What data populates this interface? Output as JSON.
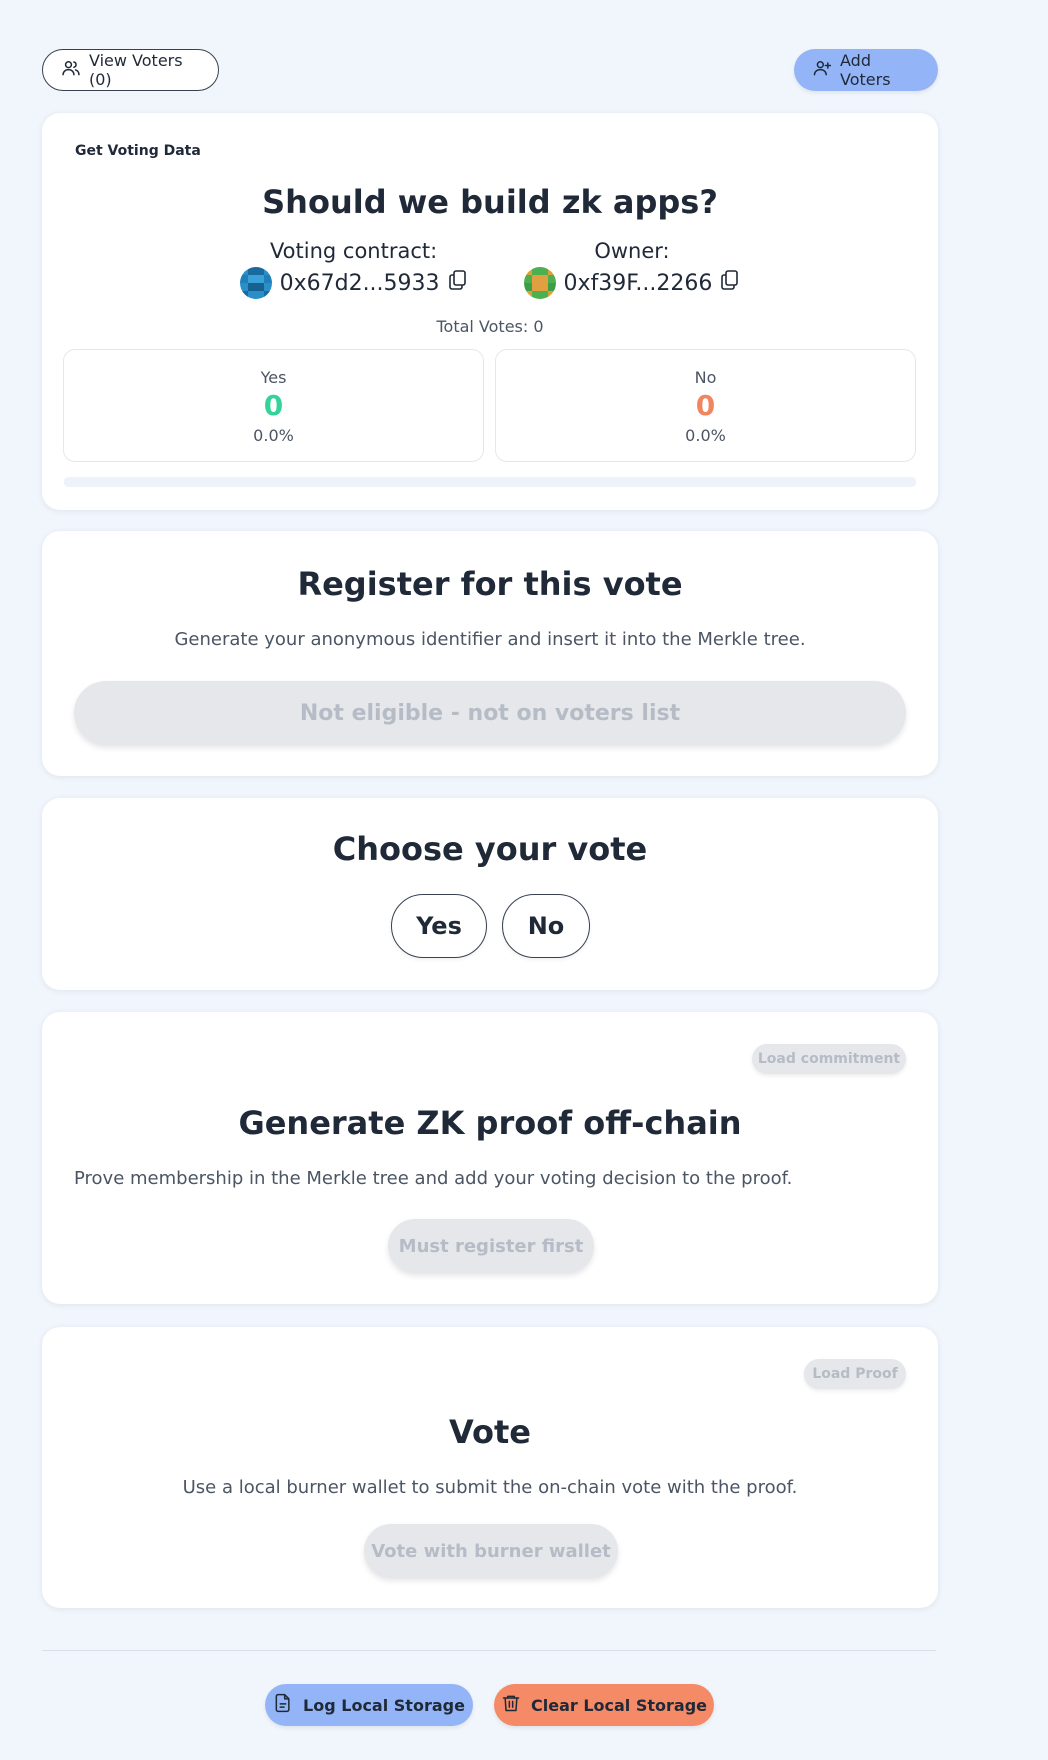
{
  "header": {
    "view_voters_label": "View Voters (0)",
    "add_voters_label": "Add Voters"
  },
  "poll": {
    "get_data_label": "Get Voting Data",
    "question": "Should we build zk apps?",
    "contract_label": "Voting contract:",
    "contract_address": "0x67d2...5933",
    "owner_label": "Owner:",
    "owner_address": "0xf39F...2266",
    "total_votes": "Total Votes: 0",
    "yes": {
      "label": "Yes",
      "count": "0",
      "percent": "0.0%",
      "color": "#34d399"
    },
    "no": {
      "label": "No",
      "count": "0",
      "percent": "0.0%",
      "color": "#f0855f"
    },
    "progress_fraction": 0
  },
  "register": {
    "title": "Register for this vote",
    "description": "Generate your anonymous identifier and insert it into the Merkle tree.",
    "button_label": "Not eligible - not on voters list"
  },
  "choose": {
    "title": "Choose your vote",
    "yes_label": "Yes",
    "no_label": "No"
  },
  "proof": {
    "chip_label": "Load commitment",
    "title": "Generate ZK proof off-chain",
    "description": "Prove membership in the Merkle tree and add your voting decision to the proof.",
    "button_label": "Must register first"
  },
  "vote": {
    "chip_label": "Load Proof",
    "title": "Vote",
    "description": "Use a local burner wallet to submit the on-chain vote with the proof.",
    "button_label": "Vote with burner wallet"
  },
  "footer": {
    "log_label": "Log Local Storage",
    "clear_label": "Clear Local Storage",
    "log_color": "#93b5f7",
    "clear_color": "#f58a66"
  },
  "icons": {
    "users": "users-icon",
    "user_plus": "user-plus-icon",
    "copy": "copy-icon",
    "document": "document-icon",
    "trash": "trash-icon"
  }
}
